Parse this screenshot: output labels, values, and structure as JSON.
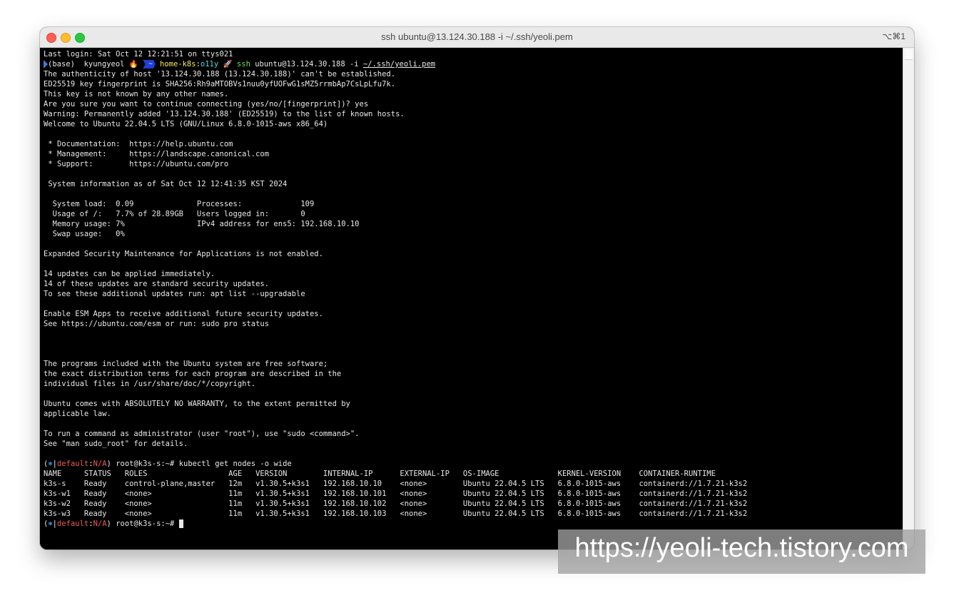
{
  "window": {
    "title": "ssh ubuntu@13.124.30.188 -i ~/.ssh/yeoli.pem",
    "shortcut": "⌥⌘1"
  },
  "terminal": {
    "last_login": "Last login: Sat Oct 12 12:21:51 on ttys021",
    "prompt": {
      "env": "(base)",
      "user": "kyungyeol",
      "fire": "🔥",
      "tilde": "~",
      "dir": "home-k8s",
      "sep": ":",
      "context": "o11y",
      "rocket": "🚀",
      "cmd": "ssh",
      "args": "ubuntu@13.124.30.188 -i",
      "key_path": "~/.ssh/yeoli.pem"
    },
    "lines_a": [
      "The authenticity of host '13.124.30.188 (13.124.30.188)' can't be established.",
      "ED25519 key fingerprint is SHA256:Rh9aMTOBVs1nuu0yfUOFwG1sMZ5rrmbAp7CsLpLfu7k.",
      "This key is not known by any other names.",
      "Are you sure you want to continue connecting (yes/no/[fingerprint])? yes",
      "Warning: Permanently added '13.124.30.188' (ED25519) to the list of known hosts.",
      "Welcome to Ubuntu 22.04.5 LTS (GNU/Linux 6.8.0-1015-aws x86_64)",
      "",
      " * Documentation:  https://help.ubuntu.com",
      " * Management:     https://landscape.canonical.com",
      " * Support:        https://ubuntu.com/pro",
      "",
      " System information as of Sat Oct 12 12:41:35 KST 2024",
      "",
      "  System load:  0.09              Processes:             109",
      "  Usage of /:   7.7% of 28.89GB   Users logged in:       0",
      "  Memory usage: 7%                IPv4 address for ens5: 192.168.10.10",
      "  Swap usage:   0%",
      "",
      "Expanded Security Maintenance for Applications is not enabled.",
      "",
      "14 updates can be applied immediately.",
      "14 of these updates are standard security updates.",
      "To see these additional updates run: apt list --upgradable",
      "",
      "Enable ESM Apps to receive additional future security updates.",
      "See https://ubuntu.com/esm or run: sudo pro status",
      "",
      "",
      "",
      "The programs included with the Ubuntu system are free software;",
      "the exact distribution terms for each program are described in the",
      "individual files in /usr/share/doc/*/copyright.",
      "",
      "Ubuntu comes with ABSOLUTELY NO WARRANTY, to the extent permitted by",
      "applicable law.",
      "",
      "To run a command as administrator (user \"root\"), use \"sudo <command>\".",
      "See \"man sudo_root\" for details.",
      ""
    ],
    "remote_prompt": {
      "open": "(",
      "icon": "⎈",
      "bar": "|",
      "ctx": "default",
      "colon": ":",
      "ns": "N/A",
      "close": ")",
      "host": " root@k3s-s:~# ",
      "command": "kubectl get nodes -o wide"
    },
    "nodes_table": [
      "NAME     STATUS   ROLES                  AGE   VERSION        INTERNAL-IP      EXTERNAL-IP   OS-IMAGE             KERNEL-VERSION    CONTAINER-RUNTIME",
      "k3s-s    Ready    control-plane,master   12m   v1.30.5+k3s1   192.168.10.10    <none>        Ubuntu 22.04.5 LTS   6.8.0-1015-aws    containerd://1.7.21-k3s2",
      "k3s-w1   Ready    <none>                 11m   v1.30.5+k3s1   192.168.10.101   <none>        Ubuntu 22.04.5 LTS   6.8.0-1015-aws    containerd://1.7.21-k3s2",
      "k3s-w2   Ready    <none>                 11m   v1.30.5+k3s1   192.168.10.102   <none>        Ubuntu 22.04.5 LTS   6.8.0-1015-aws    containerd://1.7.21-k3s2",
      "k3s-w3   Ready    <none>                 11m   v1.30.5+k3s1   192.168.10.103   <none>        Ubuntu 22.04.5 LTS   6.8.0-1015-aws    containerd://1.7.21-k3s2"
    ]
  },
  "watermark": "https://yeoli-tech.tistory.com",
  "colors": {
    "terminal_bg": "#000000",
    "text": "#e8e8e8",
    "prompt_dir": "#f7e85a",
    "prompt_context": "#57d7e0",
    "prompt_cmd": "#6ee24f",
    "kube_ctx": "#f05a5a",
    "kube_icon": "#4aa3ff"
  }
}
